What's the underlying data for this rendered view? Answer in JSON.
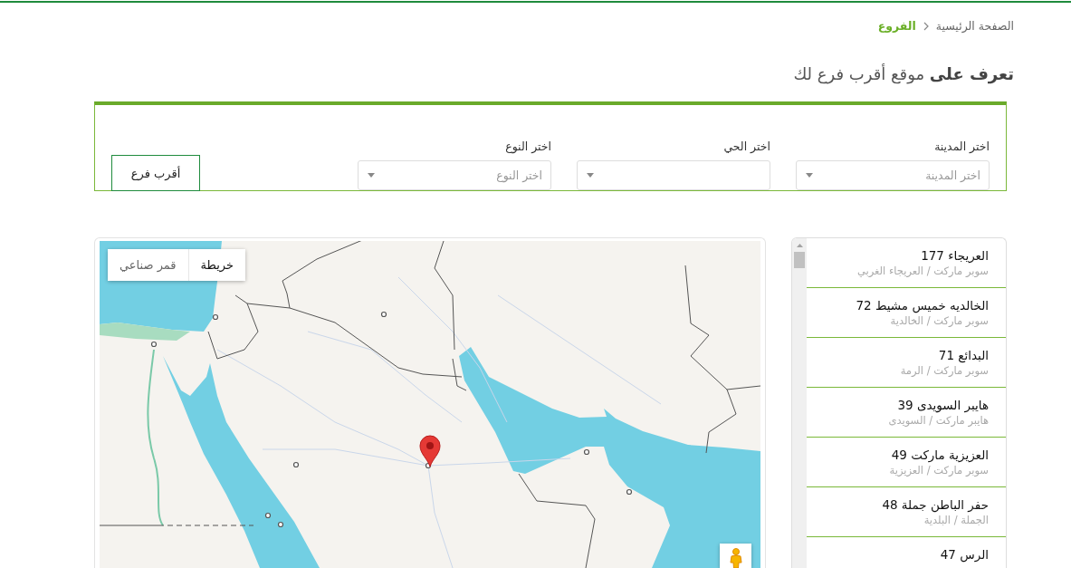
{
  "breadcrumb": [
    {
      "label": "الصفحة الرئيسية",
      "current": false
    },
    {
      "label": "الفروع",
      "current": true
    }
  ],
  "heading": "**تعرف على** موقع أقرب فرع لك",
  "filters": {
    "fields": [
      {
        "label": "اختر المدينة",
        "placeholder": "اختر المدينة"
      },
      {
        "label": "اختر الحي"
      },
      {
        "label": "اختر النوع",
        "placeholder": "اختر النوع"
      }
    ],
    "button": "أقرب فرع"
  },
  "branches": [
    {
      "name": "العريجاء 177",
      "detail": "سوبر ماركت / العريجاء الغربي"
    },
    {
      "name": "الخالديه خميس مشيط 72",
      "detail": "سوبر ماركت / الخالدية"
    },
    {
      "name": "البدائع 71",
      "detail": "سوبر ماركت / الرمة"
    },
    {
      "name": "هايبر السويدى 39",
      "detail": "هايبر ماركت / السويدى"
    },
    {
      "name": "العزيزية ماركت 49",
      "detail": "سوبر ماركت / العزيزية"
    },
    {
      "name": "حفر الباطن جملة 48",
      "detail": "الجملة / البلدية"
    },
    {
      "name": "الرس 47"
    }
  ],
  "map": {
    "map_types": [
      {
        "label": "خريطة",
        "selected": true
      },
      {
        "label": "قمر صناعي",
        "selected": false
      }
    ]
  }
}
